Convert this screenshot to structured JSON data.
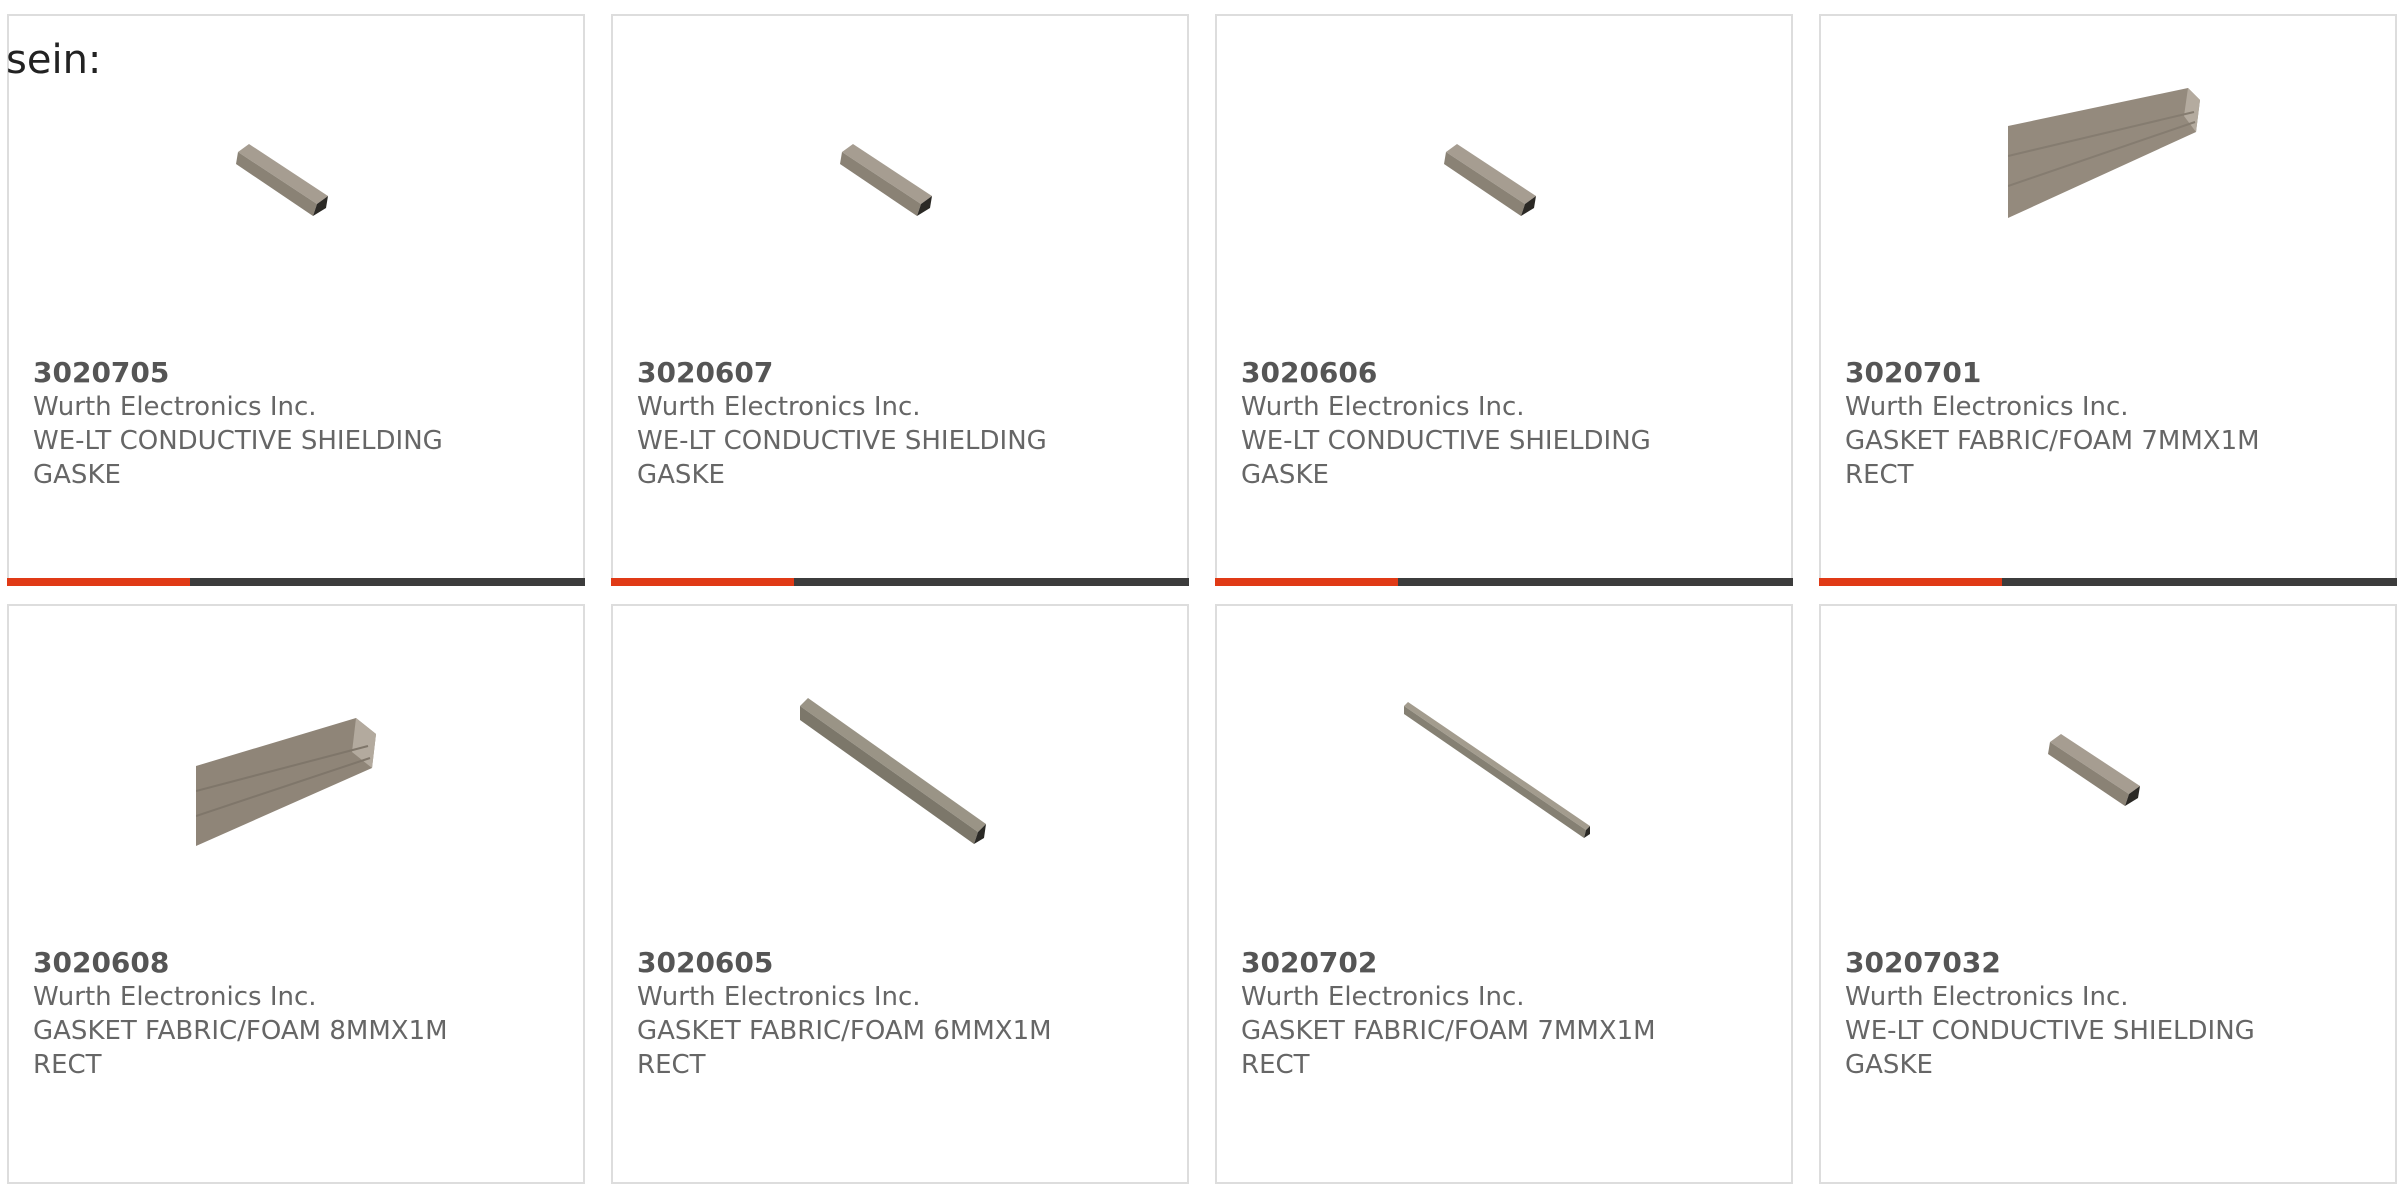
{
  "intro_text": "sein:",
  "accent_color": "#e03a16",
  "bar_color": "#3c3c3c",
  "products": [
    {
      "part_number": "3020705",
      "manufacturer": "Wurth Electronics Inc.",
      "desc_line1": "WE-LT CONDUCTIVE SHIELDING",
      "desc_line2": "GASKE",
      "image_icon": "rectangular-gasket-icon"
    },
    {
      "part_number": "3020607",
      "manufacturer": "Wurth Electronics Inc.",
      "desc_line1": "WE-LT CONDUCTIVE SHIELDING",
      "desc_line2": "GASKE",
      "image_icon": "rectangular-gasket-icon"
    },
    {
      "part_number": "3020606",
      "manufacturer": "Wurth Electronics Inc.",
      "desc_line1": "WE-LT CONDUCTIVE SHIELDING",
      "desc_line2": "GASKE",
      "image_icon": "rectangular-gasket-icon"
    },
    {
      "part_number": "3020701",
      "manufacturer": "Wurth Electronics Inc.",
      "desc_line1": "GASKET FABRIC/FOAM 7MMX1M",
      "desc_line2": "RECT",
      "image_icon": "wide-gasket-icon"
    },
    {
      "part_number": "3020608",
      "manufacturer": "Wurth Electronics Inc.",
      "desc_line1": "GASKET FABRIC/FOAM 8MMX1M",
      "desc_line2": "RECT",
      "image_icon": "wide-gasket-icon"
    },
    {
      "part_number": "3020605",
      "manufacturer": "Wurth Electronics Inc.",
      "desc_line1": "GASKET FABRIC/FOAM 6MMX1M",
      "desc_line2": "RECT",
      "image_icon": "long-gasket-icon"
    },
    {
      "part_number": "3020702",
      "manufacturer": "Wurth Electronics Inc.",
      "desc_line1": "GASKET FABRIC/FOAM 7MMX1M",
      "desc_line2": "RECT",
      "image_icon": "thin-gasket-icon"
    },
    {
      "part_number": "30207032",
      "manufacturer": "Wurth Electronics Inc.",
      "desc_line1": "WE-LT CONDUCTIVE SHIELDING",
      "desc_line2": "GASKE",
      "image_icon": "rectangular-gasket-icon"
    }
  ]
}
